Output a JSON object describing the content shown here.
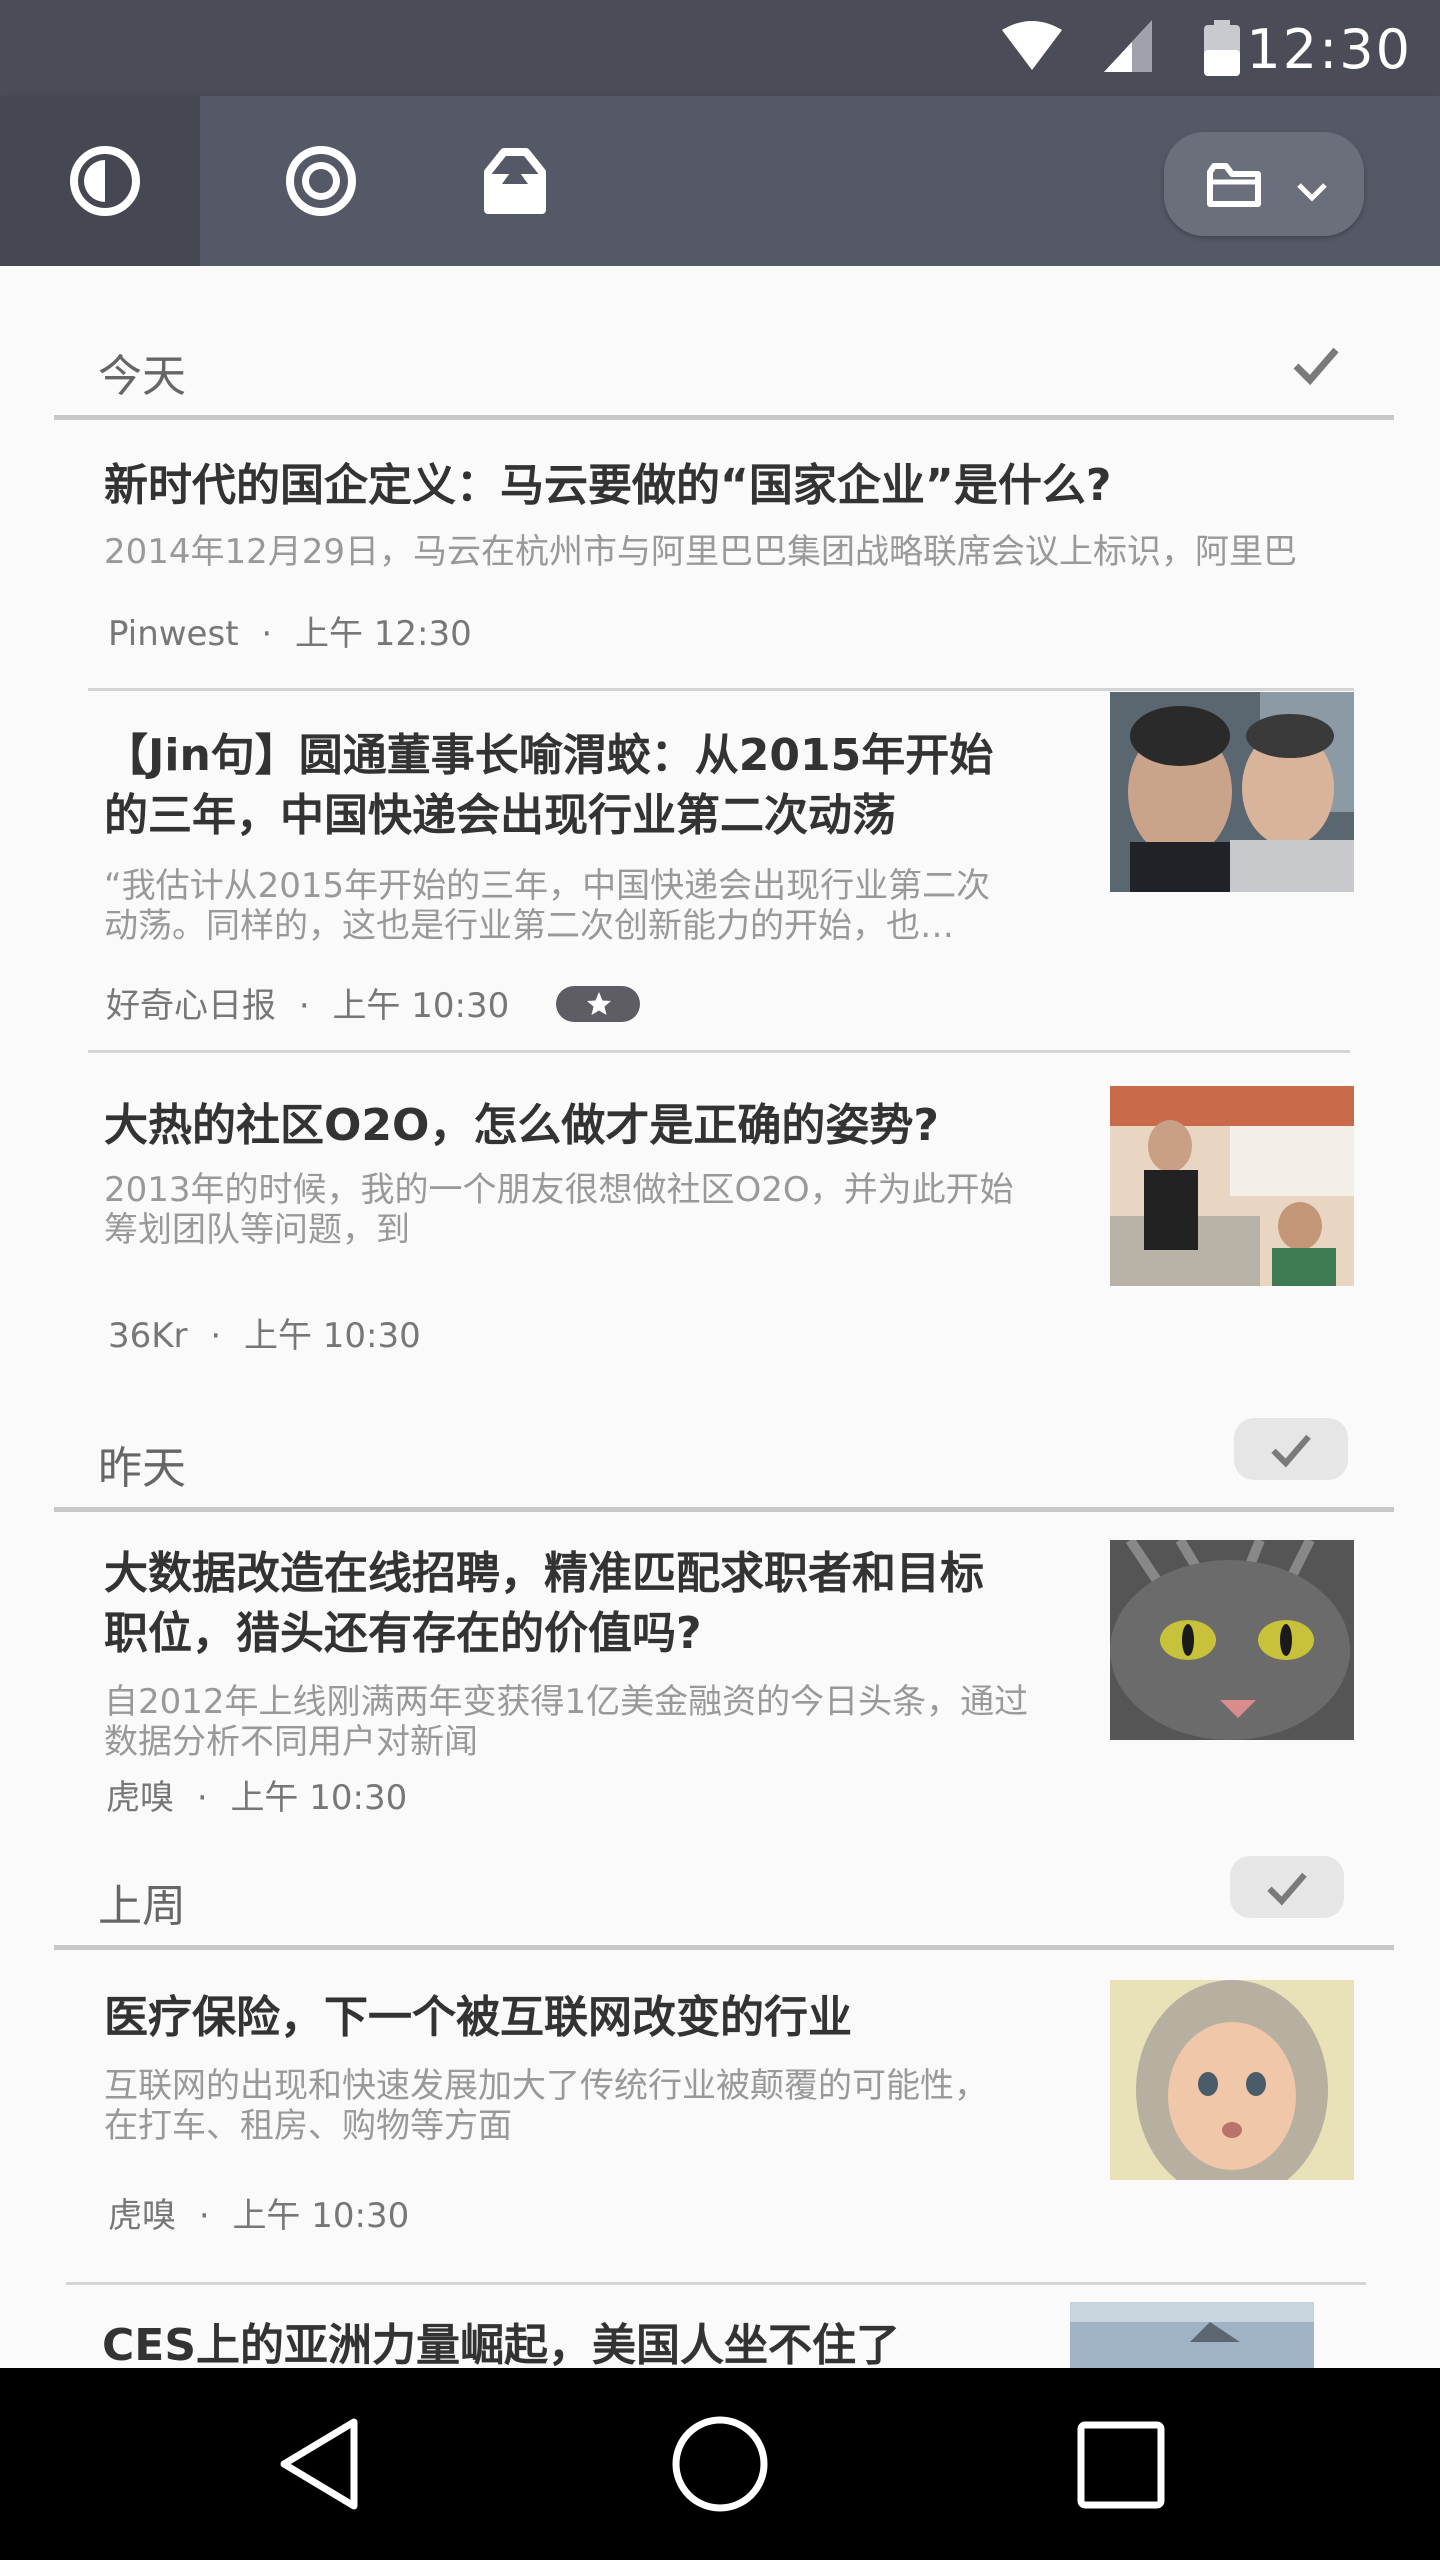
{
  "status_bar": {
    "time": "12:30",
    "icons": [
      "wifi-icon",
      "signal-icon",
      "battery-icon"
    ]
  },
  "toolbar": {
    "tabs": [
      {
        "icon": "half-circle-icon",
        "active": true
      },
      {
        "icon": "ring-icon",
        "active": false
      },
      {
        "icon": "inbox-box-icon",
        "active": false
      }
    ],
    "folder_menu": {
      "icon": "folder-icon",
      "dropdown": "chevron-down-icon"
    }
  },
  "sections": [
    {
      "label": "今天",
      "articles": [
        {
          "title": "新时代的国企定义：马云要做的“国家企业”是什么?",
          "excerpt": "2014年12月29日，马云在杭州市与阿里巴巴集团战略联席会议上标识，阿里巴",
          "source": "Pinwest",
          "time": "上午 12:30",
          "starred": false,
          "thumbnail": null
        },
        {
          "title_lines": [
            "【Jin句】圆通董事长喻渭蛟：从2015年开始",
            "的三年，中国快递会出现行业第二次动荡"
          ],
          "excerpt_lines": [
            "“我估计从2015年开始的三年，中国快递会出现行业第二次",
            "动荡。同样的，这也是行业第二次创新能力的开始，也…"
          ],
          "source": "好奇心日报",
          "time": "上午 10:30",
          "starred": true,
          "thumbnail": "photo-two-men"
        },
        {
          "title": "大热的社区O2O，怎么做才是正确的姿势?",
          "excerpt_lines": [
            "2013年的时候，我的一个朋友很想做社区O2O，并为此开始",
            "筹划团队等问题，到"
          ],
          "source": "36Kr",
          "time": "上午 10:30",
          "starred": false,
          "thumbnail": "photo-shop-counter"
        }
      ]
    },
    {
      "label": "昨天",
      "articles": [
        {
          "title_lines": [
            "大数据改造在线招聘，精准匹配求职者和目标",
            "职位，猎头还有存在的价值吗?"
          ],
          "excerpt_lines": [
            "自2012年上线刚满两年变获得1亿美金融资的今日头条，通过",
            "数据分析不同用户对新闻"
          ],
          "source": "虎嗅",
          "time": "上午 10:30",
          "starred": false,
          "thumbnail": "photo-cat"
        }
      ]
    },
    {
      "label": "上周",
      "articles": [
        {
          "title": "医疗保险，下一个被互联网改变的行业",
          "excerpt_lines": [
            "互联网的出现和快速发展加大了传统行业被颠覆的可能性，",
            "在打车、租房、购物等方面"
          ],
          "source": "虎嗅",
          "time": "上午 10:30",
          "starred": false,
          "thumbnail": "photo-baby"
        },
        {
          "title": "CES上的亚洲力量崛起，美国人坐不住了",
          "thumbnail": "photo-landscape"
        }
      ]
    }
  ],
  "meta_separator": "·",
  "colors": {
    "status_bar": "#4a4d58",
    "toolbar": "#555866",
    "toolbar_active": "#454852",
    "background": "#fafafa",
    "nav_bar": "#000000"
  },
  "nav_bar": {
    "icons": [
      "back-icon",
      "home-icon",
      "recents-icon"
    ]
  }
}
